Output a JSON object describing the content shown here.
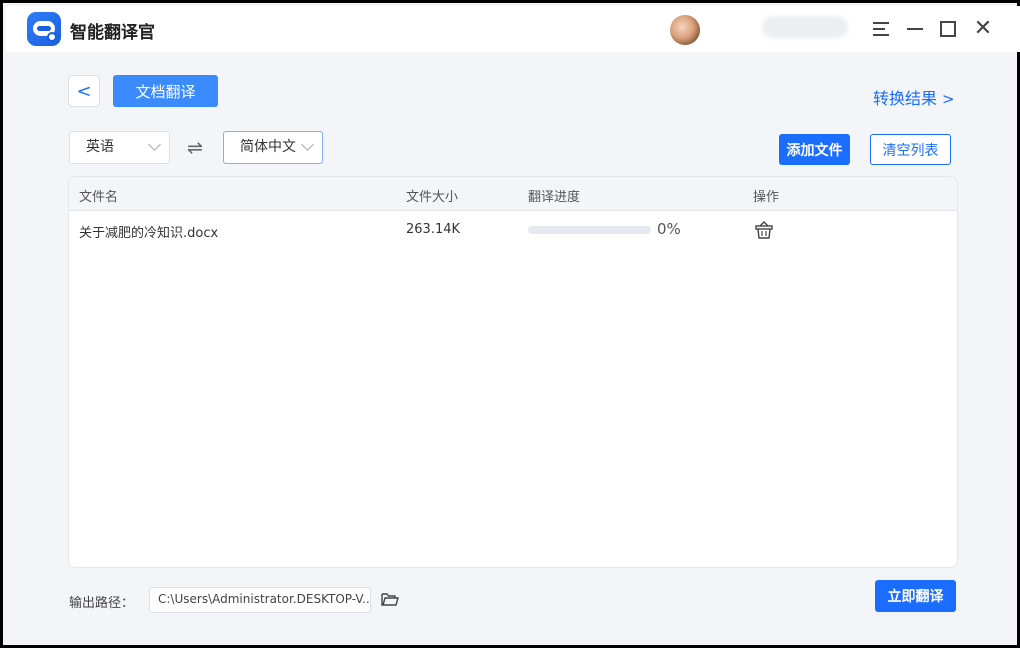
{
  "app": {
    "title": "智能翻译官"
  },
  "window_controls": {
    "menu_icon": "menu-icon",
    "minimize_icon": "minimize-icon",
    "maximize_icon": "maximize-icon",
    "close_icon": "close-icon"
  },
  "toolbar": {
    "back_icon": "<",
    "tab_label": "文档翻译",
    "result_link": "转换结果",
    "result_chevron": ">"
  },
  "languages": {
    "source": "英语",
    "target": "简体中文",
    "swap_glyph": "⇌"
  },
  "actions": {
    "add_file": "添加文件",
    "clear_list": "清空列表"
  },
  "table": {
    "columns": [
      "文件名",
      "文件大小",
      "翻译进度",
      "操作"
    ],
    "rows": [
      {
        "name": "关于减肥的冷知识.docx",
        "size": "263.14K",
        "progress": 0,
        "progress_text": "0%",
        "action_icon": "delete-basket-icon"
      }
    ]
  },
  "footer": {
    "output_label": "输出路径：",
    "output_path": "C:\\Users\\Administrator.DESKTOP-V...",
    "folder_icon": "folder-icon",
    "translate_button": "立即翻译"
  },
  "colors": {
    "accent": "#1a6dff",
    "tab_bg": "#3b8bff",
    "background": "#f3f5f8"
  }
}
